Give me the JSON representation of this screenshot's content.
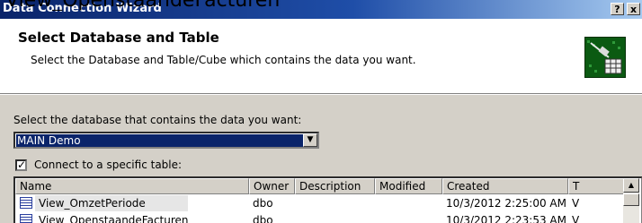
{
  "above_text": "View_OpenstaandeFacturen",
  "window": {
    "title": "Data Connection Wizard",
    "help_label": "?",
    "close_label": "x"
  },
  "header": {
    "title": "Select Database and Table",
    "subtitle": "Select the Database and Table/Cube which contains the data you want."
  },
  "database": {
    "label": "Select the database that contains the data you want:",
    "selected": "MAIN Demo"
  },
  "specific_table": {
    "label": "Connect to a specific table:",
    "checked": true
  },
  "table": {
    "columns": [
      "Name",
      "Owner",
      "Description",
      "Modified",
      "Created",
      "T"
    ],
    "rows": [
      {
        "name": "View_OmzetPeriode",
        "owner": "dbo",
        "description": "",
        "modified": "",
        "created": "10/3/2012 2:25:00 AM",
        "type": "V"
      },
      {
        "name": "View_OpenstaandeFacturen",
        "owner": "dbo",
        "description": "",
        "modified": "",
        "created": "10/3/2012 2:23:53 AM",
        "type": "V"
      }
    ]
  },
  "colors": {
    "title_bar": "#0a246a",
    "dialog_face": "#d4d0c8",
    "selection": "#0a246a"
  }
}
